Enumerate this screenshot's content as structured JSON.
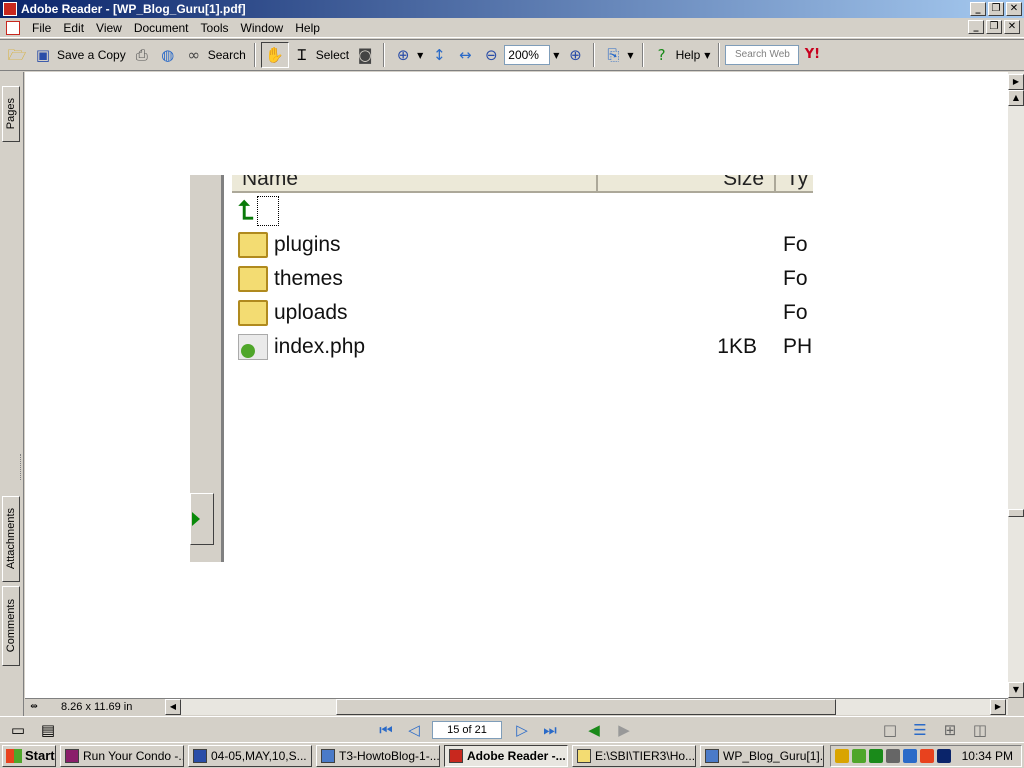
{
  "window": {
    "title": "Adobe Reader - [WP_Blog_Guru[1].pdf]"
  },
  "menu": [
    "File",
    "Edit",
    "View",
    "Document",
    "Tools",
    "Window",
    "Help"
  ],
  "toolbar": {
    "save_copy_label": "Save a Copy",
    "search_label": "Search",
    "select_label": "Select",
    "zoom_value": "200%",
    "help_label": "Help",
    "search_web_placeholder": "Search Web"
  },
  "left_tabs": {
    "pages": "Pages",
    "attachments": "Attachments",
    "comments": "Comments"
  },
  "document": {
    "explorer": {
      "columns": [
        "Name",
        "Size",
        "Ty"
      ],
      "rows": [
        {
          "name": "plugins",
          "size": "",
          "type": "Fo",
          "icon": "folder-icon"
        },
        {
          "name": "themes",
          "size": "",
          "type": "Fo",
          "icon": "folder-icon"
        },
        {
          "name": "uploads",
          "size": "",
          "type": "Fo",
          "icon": "folder-icon"
        },
        {
          "name": "index.php",
          "size": "1KB",
          "type": "PH",
          "icon": "php-file-icon"
        }
      ]
    }
  },
  "status": {
    "page_size": "8.26 x 11.69 in"
  },
  "navigation": {
    "page_indicator": "15 of 21"
  },
  "taskbar": {
    "start_label": "Start",
    "tasks": [
      {
        "label": "Run Your Condo -...",
        "active": false
      },
      {
        "label": "04-05,MAY,10,S...",
        "active": false
      },
      {
        "label": "T3-HowtoBlog-1-...",
        "active": false
      },
      {
        "label": "Adobe Reader -...",
        "active": true
      },
      {
        "label": "E:\\SBI\\TIER3\\Ho...",
        "active": false
      },
      {
        "label": "WP_Blog_Guru[1]...",
        "active": false
      }
    ],
    "clock": "10:34 PM"
  },
  "colors": {
    "title_gradient_start": "#0a246a",
    "title_gradient_end": "#a6caf0",
    "chrome": "#d4d0c8",
    "folder": "#f3dc72",
    "up_arrow": "#0a7a0a"
  }
}
